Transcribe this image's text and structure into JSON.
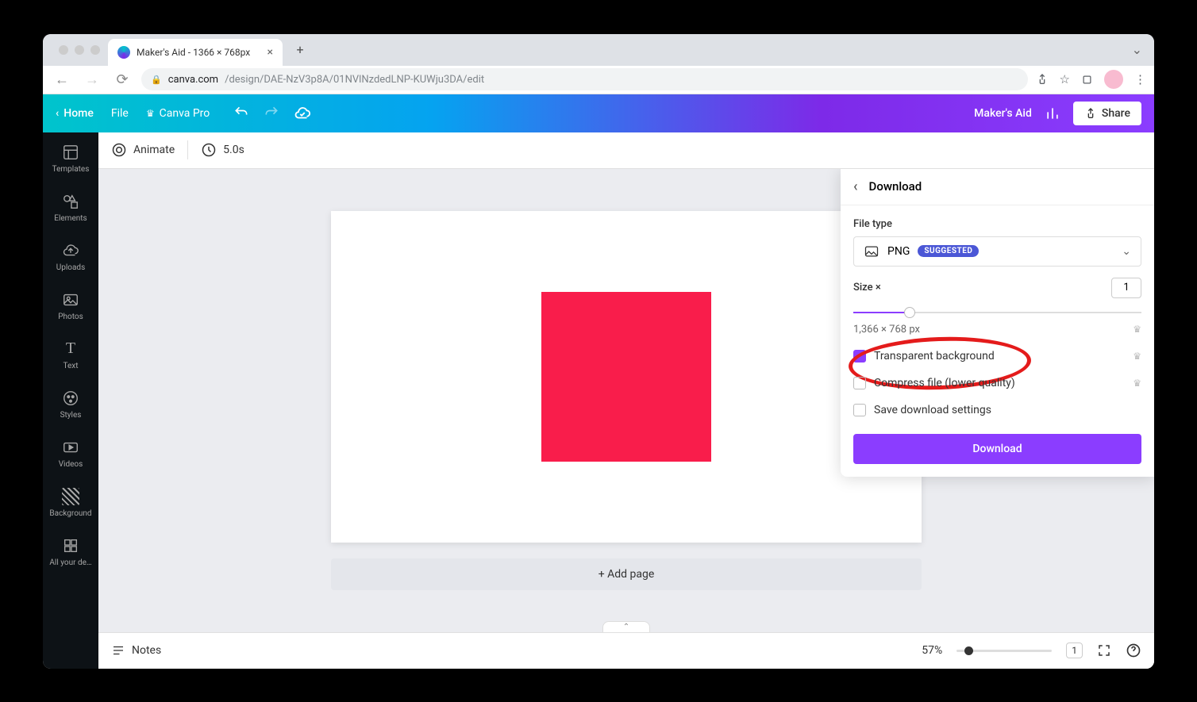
{
  "browser": {
    "tab_title": "Maker's Aid - 1366 × 768px",
    "url_domain": "canva.com",
    "url_path": "/design/DAE-NzV3p8A/01NVlNzdedLNP-KUWju3DA/edit"
  },
  "appbar": {
    "home": "Home",
    "file": "File",
    "pro": "Canva Pro",
    "project_name": "Maker's Aid",
    "share": "Share"
  },
  "sidebar": {
    "items": [
      {
        "label": "Templates"
      },
      {
        "label": "Elements"
      },
      {
        "label": "Uploads"
      },
      {
        "label": "Photos"
      },
      {
        "label": "Text"
      },
      {
        "label": "Styles"
      },
      {
        "label": "Videos"
      },
      {
        "label": "Background"
      },
      {
        "label": "All your de…"
      }
    ]
  },
  "toolbar": {
    "animate": "Animate",
    "duration": "5.0s"
  },
  "canvas": {
    "add_page": "+ Add page"
  },
  "footer": {
    "notes": "Notes",
    "zoom": "57%",
    "page_indicator": "1"
  },
  "download": {
    "title": "Download",
    "file_type_label": "File type",
    "file_type_value": "PNG",
    "suggested_badge": "SUGGESTED",
    "size_label": "Size ×",
    "size_value": "1",
    "dimensions": "1,366 × 768 px",
    "opt_transparent": "Transparent background",
    "opt_compress": "Compress file (lower quality)",
    "opt_save": "Save download settings",
    "button": "Download"
  }
}
